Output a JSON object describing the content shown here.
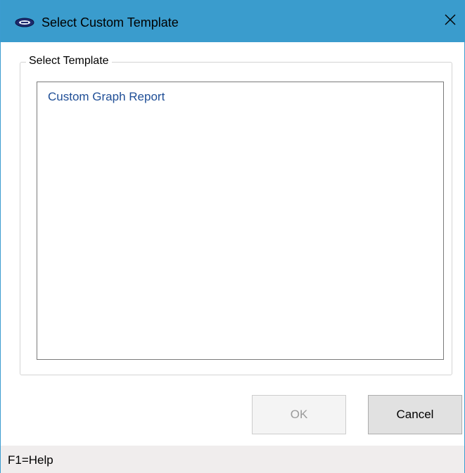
{
  "window": {
    "title": "Select Custom Template",
    "icon": "app-logo-icon",
    "close_icon": "close-icon",
    "titlebar_color": "#3a9ccd"
  },
  "group": {
    "legend": "Select Template"
  },
  "template_list": {
    "items": [
      {
        "label": "Custom Graph Report"
      }
    ],
    "item_color": "#1f4e96"
  },
  "buttons": {
    "ok_label": "OK",
    "ok_enabled": false,
    "cancel_label": "Cancel"
  },
  "status_bar": {
    "text": "F1=Help"
  }
}
